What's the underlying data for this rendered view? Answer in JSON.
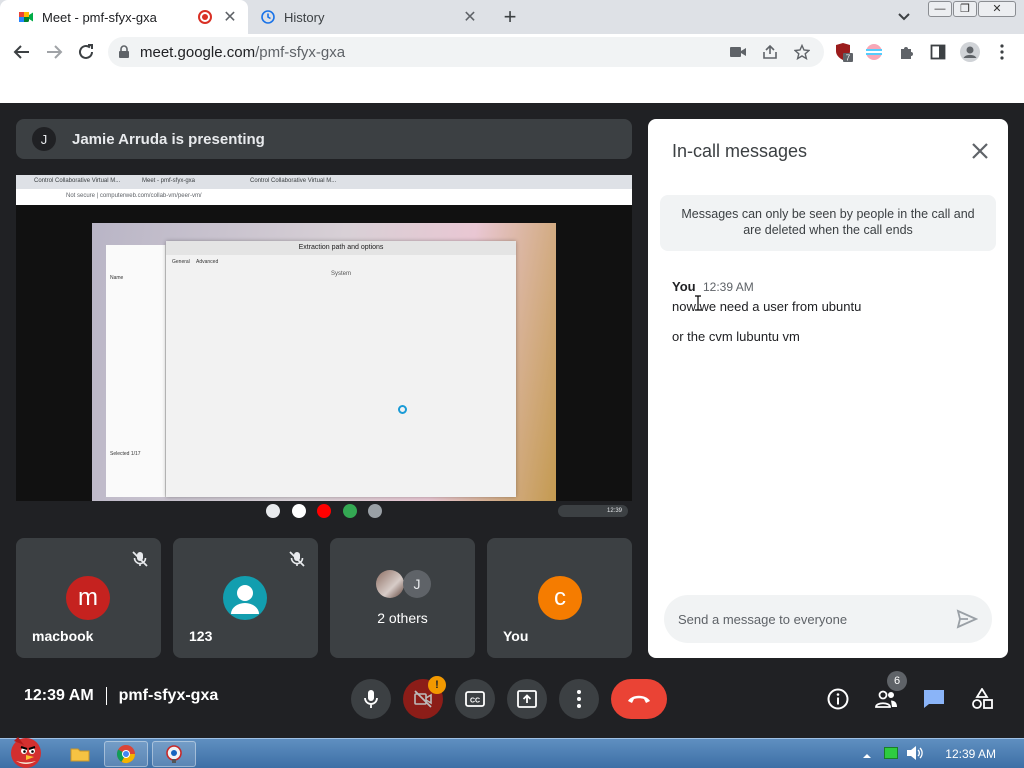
{
  "browser": {
    "tabs": [
      {
        "title": "Meet - pmf-sfyx-gxa",
        "active": true
      },
      {
        "title": "History",
        "active": false
      }
    ],
    "address": {
      "host": "meet.google.com",
      "path": "/pmf-sfyx-gxa"
    },
    "extension_badge": "7"
  },
  "meet": {
    "presenter": {
      "initial": "J",
      "text": "Jamie Arruda is presenting"
    },
    "shared_screen": {
      "tabs": [
        "Control Collaborative Virtual M...",
        "Meet - pmf-sfyx-gxa",
        "Control Collaborative Virtual M..."
      ],
      "address": "Not secure | computerweb.com/collab-vm/peer-vm/",
      "dialog_title": "Extraction path and options",
      "system_label": "System",
      "dialog_tabs": [
        "General",
        "Advanced"
      ],
      "left_pane": [
        "Name",
        "Selected 1/17"
      ],
      "clock": "12:39"
    },
    "participants": [
      {
        "initial": "m",
        "name": "macbook",
        "muted": true,
        "color": "#c5221f"
      },
      {
        "initial": "",
        "name": "123",
        "muted": true,
        "color": "#129eaf"
      },
      {
        "initial": "J",
        "name": "2 others",
        "muted": false,
        "color": "#5f6368"
      },
      {
        "initial": "c",
        "name": "You",
        "muted": false,
        "color": "#f57c00"
      }
    ],
    "time": "12:39 AM",
    "meeting_code": "pmf-sfyx-gxa",
    "camera_warning": "!",
    "people_count": "6"
  },
  "chat": {
    "title": "In-call messages",
    "notice": "Messages can only be seen by people in the call and are deleted when the call ends",
    "sender": "You",
    "time": "12:39 AM",
    "messages": [
      "now we need a user from ubuntu",
      "or the cvm lubuntu vm"
    ],
    "placeholder": "Send a message to everyone"
  },
  "taskbar": {
    "clock": "12:39 AM"
  }
}
